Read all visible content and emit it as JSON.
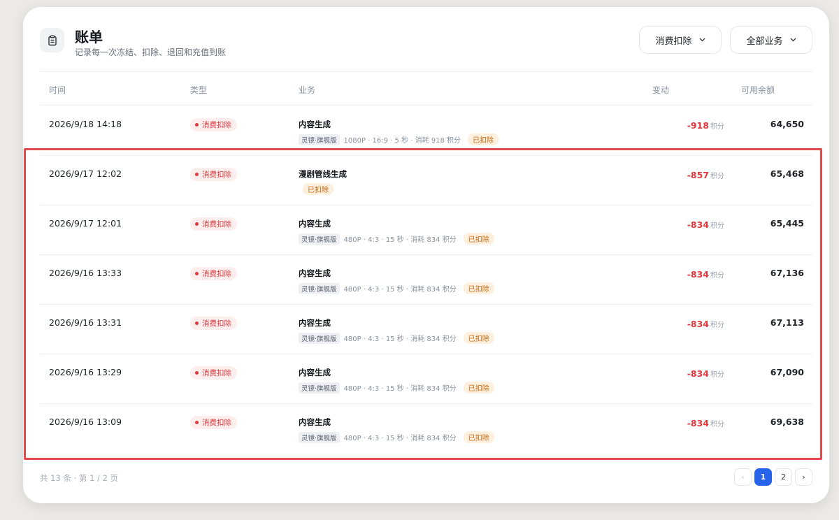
{
  "header": {
    "title": "账单",
    "subtitle": "记录每一次冻结、扣除、退回和充值到账",
    "icon": "clipboard-icon",
    "filter_type": "消费扣除",
    "filter_business": "全部业务"
  },
  "columns": {
    "time": "时间",
    "type": "类型",
    "business": "业务",
    "change": "变动",
    "balance": "可用余额"
  },
  "rows": [
    {
      "time": "2026/9/18 14:18",
      "type": "消费扣除",
      "title": "内容生成",
      "model": "灵镜·旗舰版",
      "meta": "1080P · 16:9 · 5 秒 · 消耗 918 积分",
      "status": "已扣除",
      "change": "-918",
      "unit": "积分",
      "balance": "64,650"
    },
    {
      "time": "2026/9/17 12:02",
      "type": "消费扣除",
      "title": "漫剧管线生成",
      "model": "",
      "meta": "",
      "status": "已扣除",
      "change": "-857",
      "unit": "积分",
      "balance": "65,468"
    },
    {
      "time": "2026/9/17 12:01",
      "type": "消费扣除",
      "title": "内容生成",
      "model": "灵镜·旗舰版",
      "meta": "480P · 4:3 · 15 秒 · 消耗 834 积分",
      "status": "已扣除",
      "change": "-834",
      "unit": "积分",
      "balance": "65,445"
    },
    {
      "time": "2026/9/16 13:33",
      "type": "消费扣除",
      "title": "内容生成",
      "model": "灵镜·旗舰版",
      "meta": "480P · 4:3 · 15 秒 · 消耗 834 积分",
      "status": "已扣除",
      "change": "-834",
      "unit": "积分",
      "balance": "67,136"
    },
    {
      "time": "2026/9/16 13:31",
      "type": "消费扣除",
      "title": "内容生成",
      "model": "灵镜·旗舰版",
      "meta": "480P · 4:3 · 15 秒 · 消耗 834 积分",
      "status": "已扣除",
      "change": "-834",
      "unit": "积分",
      "balance": "67,113"
    },
    {
      "time": "2026/9/16 13:29",
      "type": "消费扣除",
      "title": "内容生成",
      "model": "灵镜·旗舰版",
      "meta": "480P · 4:3 · 15 秒 · 消耗 834 积分",
      "status": "已扣除",
      "change": "-834",
      "unit": "积分",
      "balance": "67,090"
    },
    {
      "time": "2026/9/16 13:09",
      "type": "消费扣除",
      "title": "内容生成",
      "model": "灵镜·旗舰版",
      "meta": "480P · 4:3 · 15 秒 · 消耗 834 积分",
      "status": "已扣除",
      "change": "-834",
      "unit": "积分",
      "balance": "69,638"
    }
  ],
  "footer": {
    "summary": "共 13 条 · 第 1 / 2 页",
    "prev": "‹",
    "pages": [
      "1",
      "2"
    ],
    "next": "›",
    "current_page": "1"
  },
  "colors": {
    "accent": "#2563eb",
    "deduct_red": "#e0393e",
    "status_orange": "#c96a12",
    "highlight_border": "#e24a4e"
  }
}
